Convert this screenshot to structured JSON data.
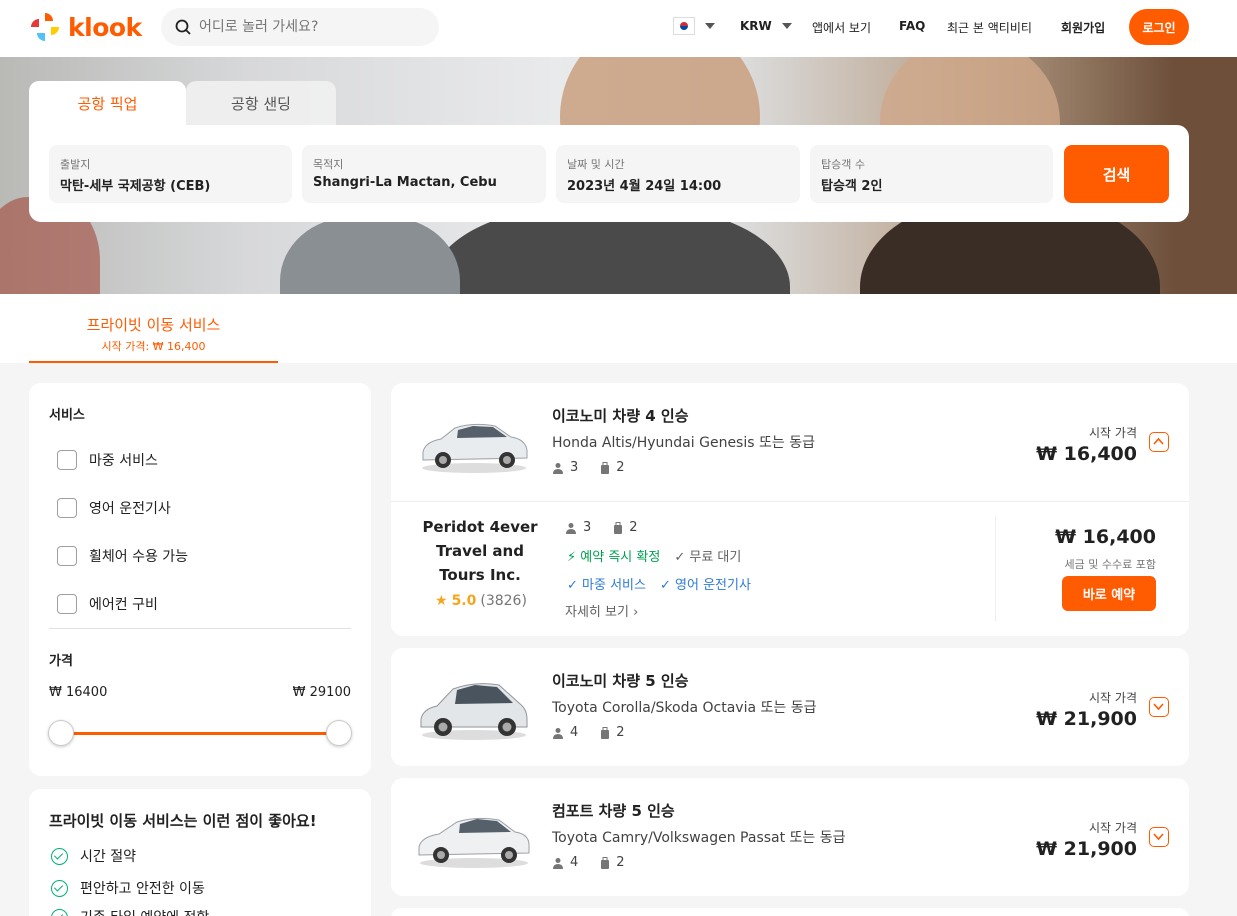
{
  "header": {
    "logo_text": "klook",
    "search_placeholder": "어디로 놀러 가세요?",
    "currency": "KRW",
    "nav": [
      "앱에서 보기",
      "FAQ",
      "최근 본 액티비티",
      "회원가입"
    ],
    "login": "로그인"
  },
  "tabs": [
    "공항 픽업",
    "공항 샌딩"
  ],
  "search_form": {
    "from_label": "출발지",
    "from_value": "막탄-세부 국제공항 (CEB)",
    "to_label": "목적지",
    "to_value": "Shangri-La Mactan, Cebu",
    "date_label": "날짜 및 시간",
    "date_value": "2023년 4월 24일 14:00",
    "pax_label": "탑승객 수",
    "pax_value": "탑승객 2인",
    "search_button": "검색"
  },
  "service_tab": {
    "title": "프라이빗 이동 서비스",
    "price": "시작 가격: ₩ 16,400"
  },
  "filters": {
    "service_heading": "서비스",
    "options": [
      "마중 서비스",
      "영어 운전기사",
      "휠체어 수용 가능",
      "에어컨 구비"
    ],
    "price_heading": "가격",
    "price_min": "₩ 16400",
    "price_max": "₩ 29100"
  },
  "benefits": {
    "title": "프라이빗 이동 서비스는 이런 점이 좋아요!",
    "items": [
      "시간 절약",
      "편안하고 안전한 이동",
      "기존 타입 예약에 적합"
    ]
  },
  "cards": [
    {
      "title": "이코노미 차량 4 인승",
      "subtitle": "Honda Altis/Hyundai Genesis 또는 동급",
      "passengers": "3",
      "bags": "2",
      "from_label": "시작 가격",
      "from_price": "₩ 16,400"
    },
    {
      "title": "이코노미 차량 5 인승",
      "subtitle": "Toyota Corolla/Skoda Octavia 또는 동급",
      "passengers": "4",
      "bags": "2",
      "from_label": "시작 가격",
      "from_price": "₩ 21,900"
    },
    {
      "title": "컴포트 차량 5 인승",
      "subtitle": "Toyota Camry/Volkswagen Passat 또는 동급",
      "passengers": "4",
      "bags": "2",
      "from_label": "시작 가격",
      "from_price": "₩ 21,900"
    }
  ],
  "offer": {
    "vendor": "Peridot 4ever Travel and Tours Inc.",
    "rating": "5.0",
    "reviews": "(3826)",
    "passengers": "3",
    "bags": "2",
    "instant": "예약 즉시 확정",
    "free_wait": "무료 대기",
    "meet": "마중 서비스",
    "english": "영어 운전기사",
    "details": "자세히 보기",
    "price": "₩ 16,400",
    "tax_note": "세금 및 수수료 포함",
    "book": "바로 예약"
  },
  "colors": {
    "brand": "#ff5b00",
    "green": "#00a050",
    "blue": "#2e7bd6",
    "star": "#f7a51d"
  }
}
